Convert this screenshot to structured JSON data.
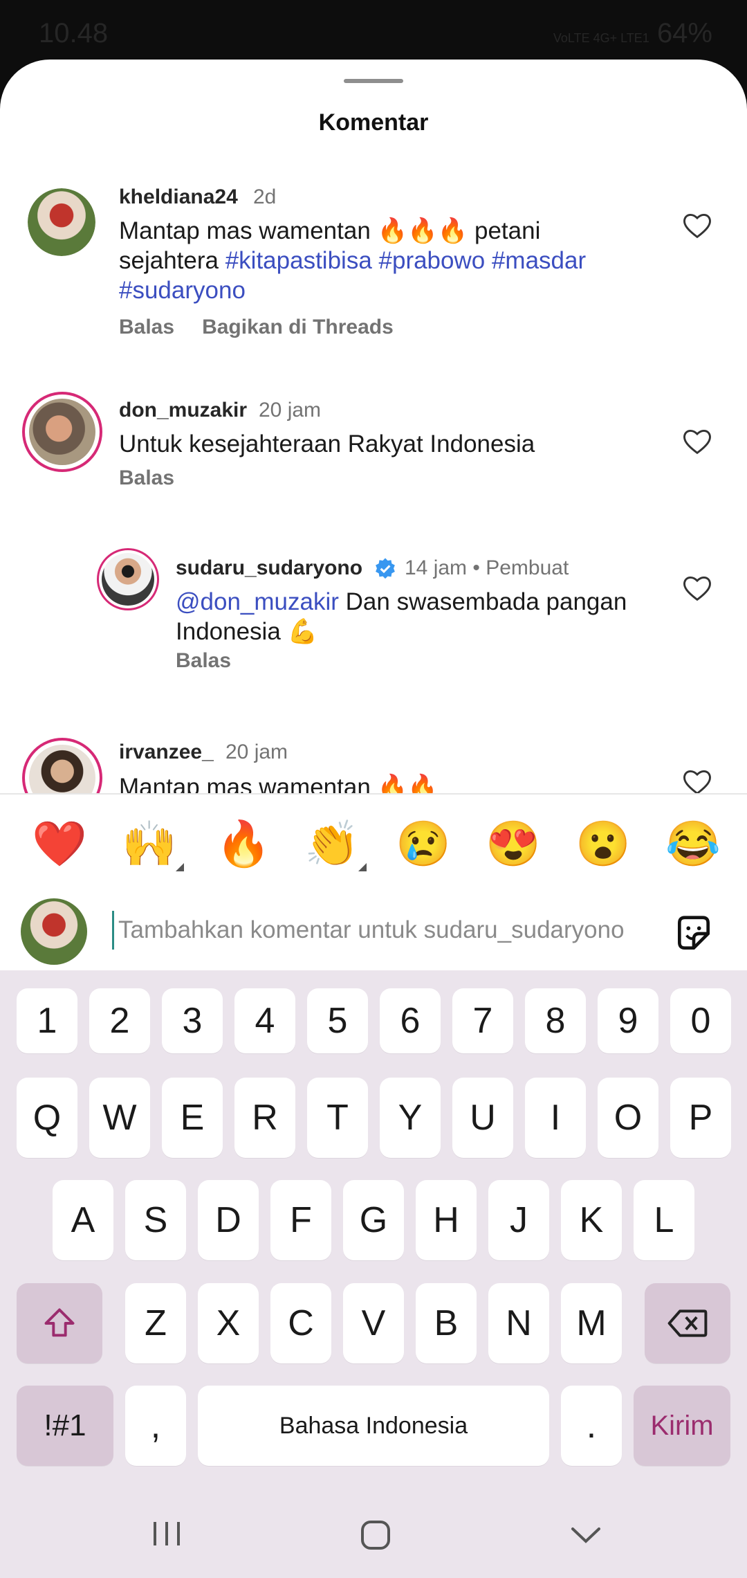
{
  "status_bar": {
    "time": "10.48",
    "battery": "64%",
    "network": "VoLTE 4G+ LTE1"
  },
  "sheet": {
    "title": "Komentar"
  },
  "comments": [
    {
      "username": "kheldiana24",
      "time": "2d",
      "text_parts": [
        "Mantap mas wamentan 🔥🔥🔥 petani sejahtera ",
        "#kitapastibisa #prabowo #masdar #sudaryono"
      ],
      "actions": [
        "Balas",
        "Bagikan di Threads"
      ]
    },
    {
      "username": "don_muzakir",
      "time": "20 jam",
      "text": "Untuk kesejahteraan Rakyat Indonesia",
      "actions": [
        "Balas"
      ]
    },
    {
      "username": "sudaru_sudaryono",
      "time": "14 jam",
      "badge": "Pembuat",
      "mention": "@don_muzakir",
      "text": " Dan swasembada pangan Indonesia 💪",
      "actions": [
        "Balas"
      ]
    },
    {
      "username": "irvanzee_",
      "time": "20 jam",
      "text": "Mantap mas wamentan 🔥🔥"
    }
  ],
  "reactions": [
    "❤️",
    "🙌",
    "🔥",
    "👏",
    "😢",
    "😍",
    "😮",
    "😂"
  ],
  "comment_input": {
    "placeholder": "Tambahkan komentar untuk sudaru_sudaryono"
  },
  "keyboard": {
    "row_numbers": [
      "1",
      "2",
      "3",
      "4",
      "5",
      "6",
      "7",
      "8",
      "9",
      "0"
    ],
    "row_1": [
      "Q",
      "W",
      "E",
      "R",
      "T",
      "Y",
      "U",
      "I",
      "O",
      "P"
    ],
    "row_2": [
      "A",
      "S",
      "D",
      "F",
      "G",
      "H",
      "J",
      "K",
      "L"
    ],
    "row_3": [
      "Z",
      "X",
      "C",
      "V",
      "B",
      "N",
      "M"
    ],
    "symbols": "!#1",
    "comma": ",",
    "space": "Bahasa Indonesia",
    "period": ".",
    "send": "Kirim"
  },
  "colors": {
    "hashtag": "#3b4ec0",
    "send": "#9b2c6e",
    "verified": "#3897f0",
    "keyboard_bg": "#ebe4ec"
  }
}
